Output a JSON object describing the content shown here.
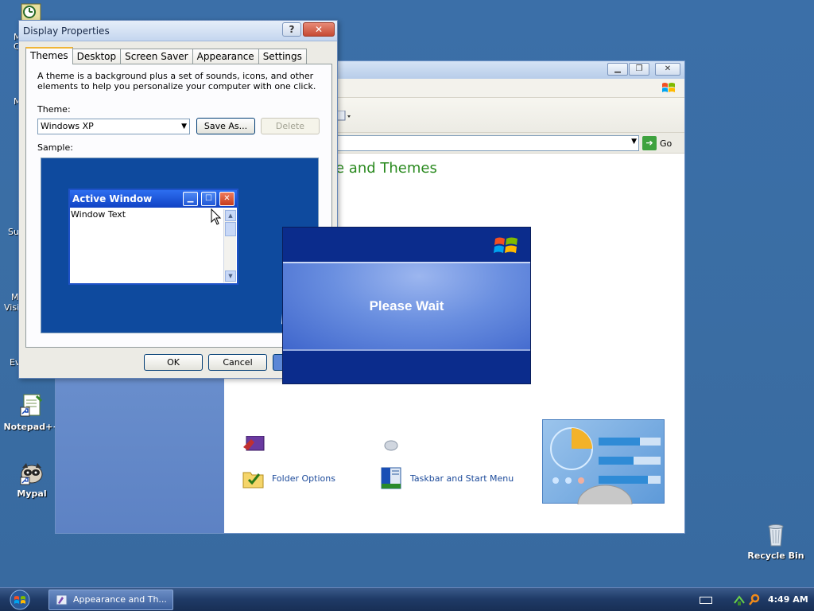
{
  "desktop": {
    "icons": [
      {
        "label": "Notepad++"
      },
      {
        "label": "Mypal"
      },
      {
        "label": "Recycle Bin"
      }
    ],
    "partial_labels": [
      "M",
      "C",
      "M",
      "Su",
      "M",
      "Visi",
      "Ev"
    ]
  },
  "control_panel": {
    "go_label": "Go",
    "heading": "e and Themes",
    "tasks": [
      {
        "label": "Folder Options",
        "icon": "folder-options-icon"
      },
      {
        "label": "Taskbar and Start Menu",
        "icon": "taskbar-start-menu-icon"
      }
    ]
  },
  "display_properties": {
    "title": "Display Properties",
    "help_glyph": "?",
    "close_glyph": "✕",
    "tabs": [
      "Themes",
      "Desktop",
      "Screen Saver",
      "Appearance",
      "Settings"
    ],
    "active_tab": "Themes",
    "description": "A theme is a background plus a set of sounds, icons, and other elements to help you personalize your computer with one click.",
    "theme_label": "Theme:",
    "theme_value": "Windows XP",
    "save_as_label": "Save As...",
    "delete_label": "Delete",
    "sample_label": "Sample:",
    "sample_window": {
      "title": "Active Window",
      "text": "Window Text"
    },
    "ok_label": "OK",
    "cancel_label": "Cancel"
  },
  "please_wait": {
    "text": "Please Wait"
  },
  "taskbar": {
    "task_button_label": "Appearance and Th...",
    "clock": "4:49 AM"
  }
}
